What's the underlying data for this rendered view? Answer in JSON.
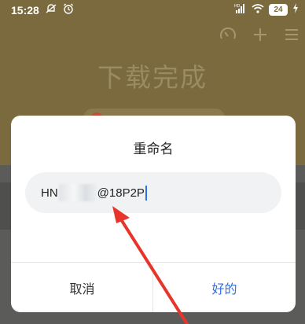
{
  "status_bar": {
    "time": "15:28",
    "battery_level": "24",
    "network_label": "HD"
  },
  "app": {
    "title": "下载完成"
  },
  "dialog": {
    "title": "重命名",
    "input": {
      "value_prefix": "HN",
      "value_suffix": "@18P2P"
    },
    "cancel_label": "取消",
    "ok_label": "好的"
  },
  "colors": {
    "accent": "#2e6fe8",
    "annotation_arrow": "#e8352c",
    "background_overlay": "#7a6a3d"
  },
  "icons": [
    "mute-bell-icon",
    "alarm-clock-icon",
    "signal-icon",
    "wifi-icon",
    "battery-icon",
    "charging-bolt-icon",
    "speed-gauge-icon",
    "add-icon",
    "menu-icon"
  ]
}
